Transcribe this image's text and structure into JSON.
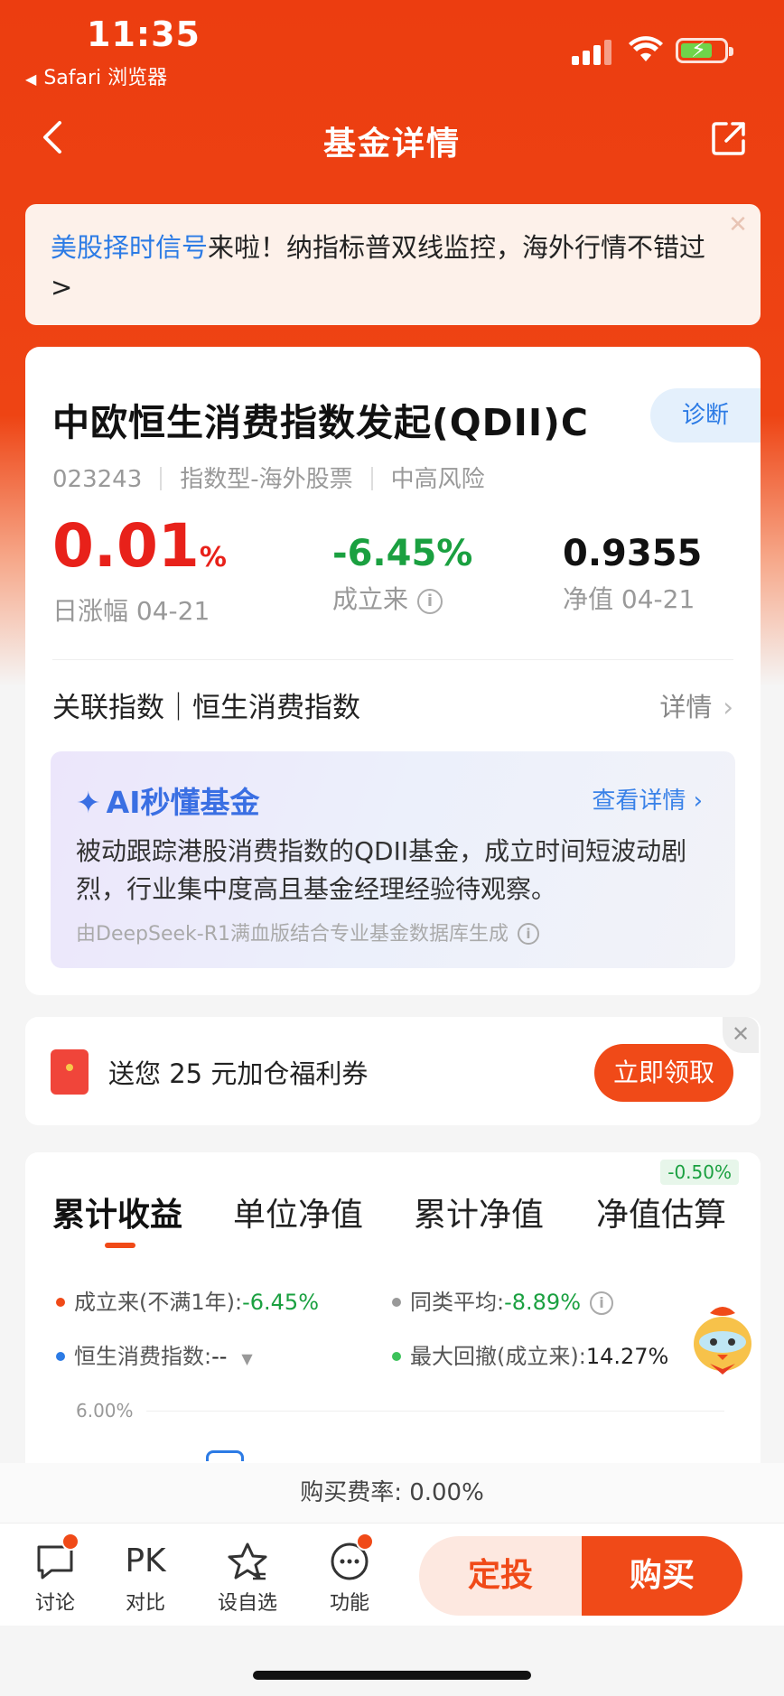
{
  "status_bar": {
    "time": "11:35",
    "back_app": "Safari 浏览器"
  },
  "nav": {
    "title": "基金详情"
  },
  "banner": {
    "highlight": "美股择时信号",
    "text": "来啦！纳指标普双线监控，海外行情不错过 >"
  },
  "fund": {
    "name": "中欧恒生消费指数发起(QDII)C",
    "diagnose": "诊断",
    "code": "023243",
    "type": "指数型-海外股票",
    "risk": "中高风险",
    "daily_change_value": "0.01",
    "daily_change_unit": "%",
    "daily_change_label": "日涨幅 04-21",
    "since_inception": "-6.45%",
    "since_inception_label": "成立来",
    "nav": "0.9355",
    "nav_label": "净值 04-21",
    "related_index": "关联指数｜恒生消费指数",
    "related_detail": "详情"
  },
  "ai": {
    "title": "AI秒懂基金",
    "more": "查看详情",
    "text": "被动跟踪港股消费指数的QDII基金，成立时间短波动剧烈，行业集中度高且基金经理经验待观察。",
    "source": "由DeepSeek-R1满血版结合专业基金数据库生成"
  },
  "coupon": {
    "text": "送您 25 元加仓福利券",
    "button": "立即领取"
  },
  "performance": {
    "tabs": [
      "累计收益",
      "单位净值",
      "累计净值",
      "净值估算"
    ],
    "estimate_badge": "-0.50%",
    "legend": [
      {
        "label": "成立来(不满1年):",
        "value": "-6.45%",
        "color": "#f04a18"
      },
      {
        "label": "同类平均:",
        "value": "-8.89%",
        "color": "#999999"
      },
      {
        "label": "恒生消费指数:",
        "value": "--",
        "color": "#2c7be5"
      },
      {
        "label": "最大回撤(成立来):",
        "value": "14.27%",
        "color": "#3cc25a"
      }
    ],
    "y_tick": "6.00%"
  },
  "fee": {
    "text": "购买费率: 0.00%"
  },
  "bottom_bar": {
    "items": [
      {
        "label": "讨论",
        "icon": "chat-icon"
      },
      {
        "label": "对比",
        "icon": "PK"
      },
      {
        "label": "设自选",
        "icon": "star-icon"
      },
      {
        "label": "功能",
        "icon": "more-icon"
      }
    ],
    "dingtou": "定投",
    "buy": "购买"
  }
}
